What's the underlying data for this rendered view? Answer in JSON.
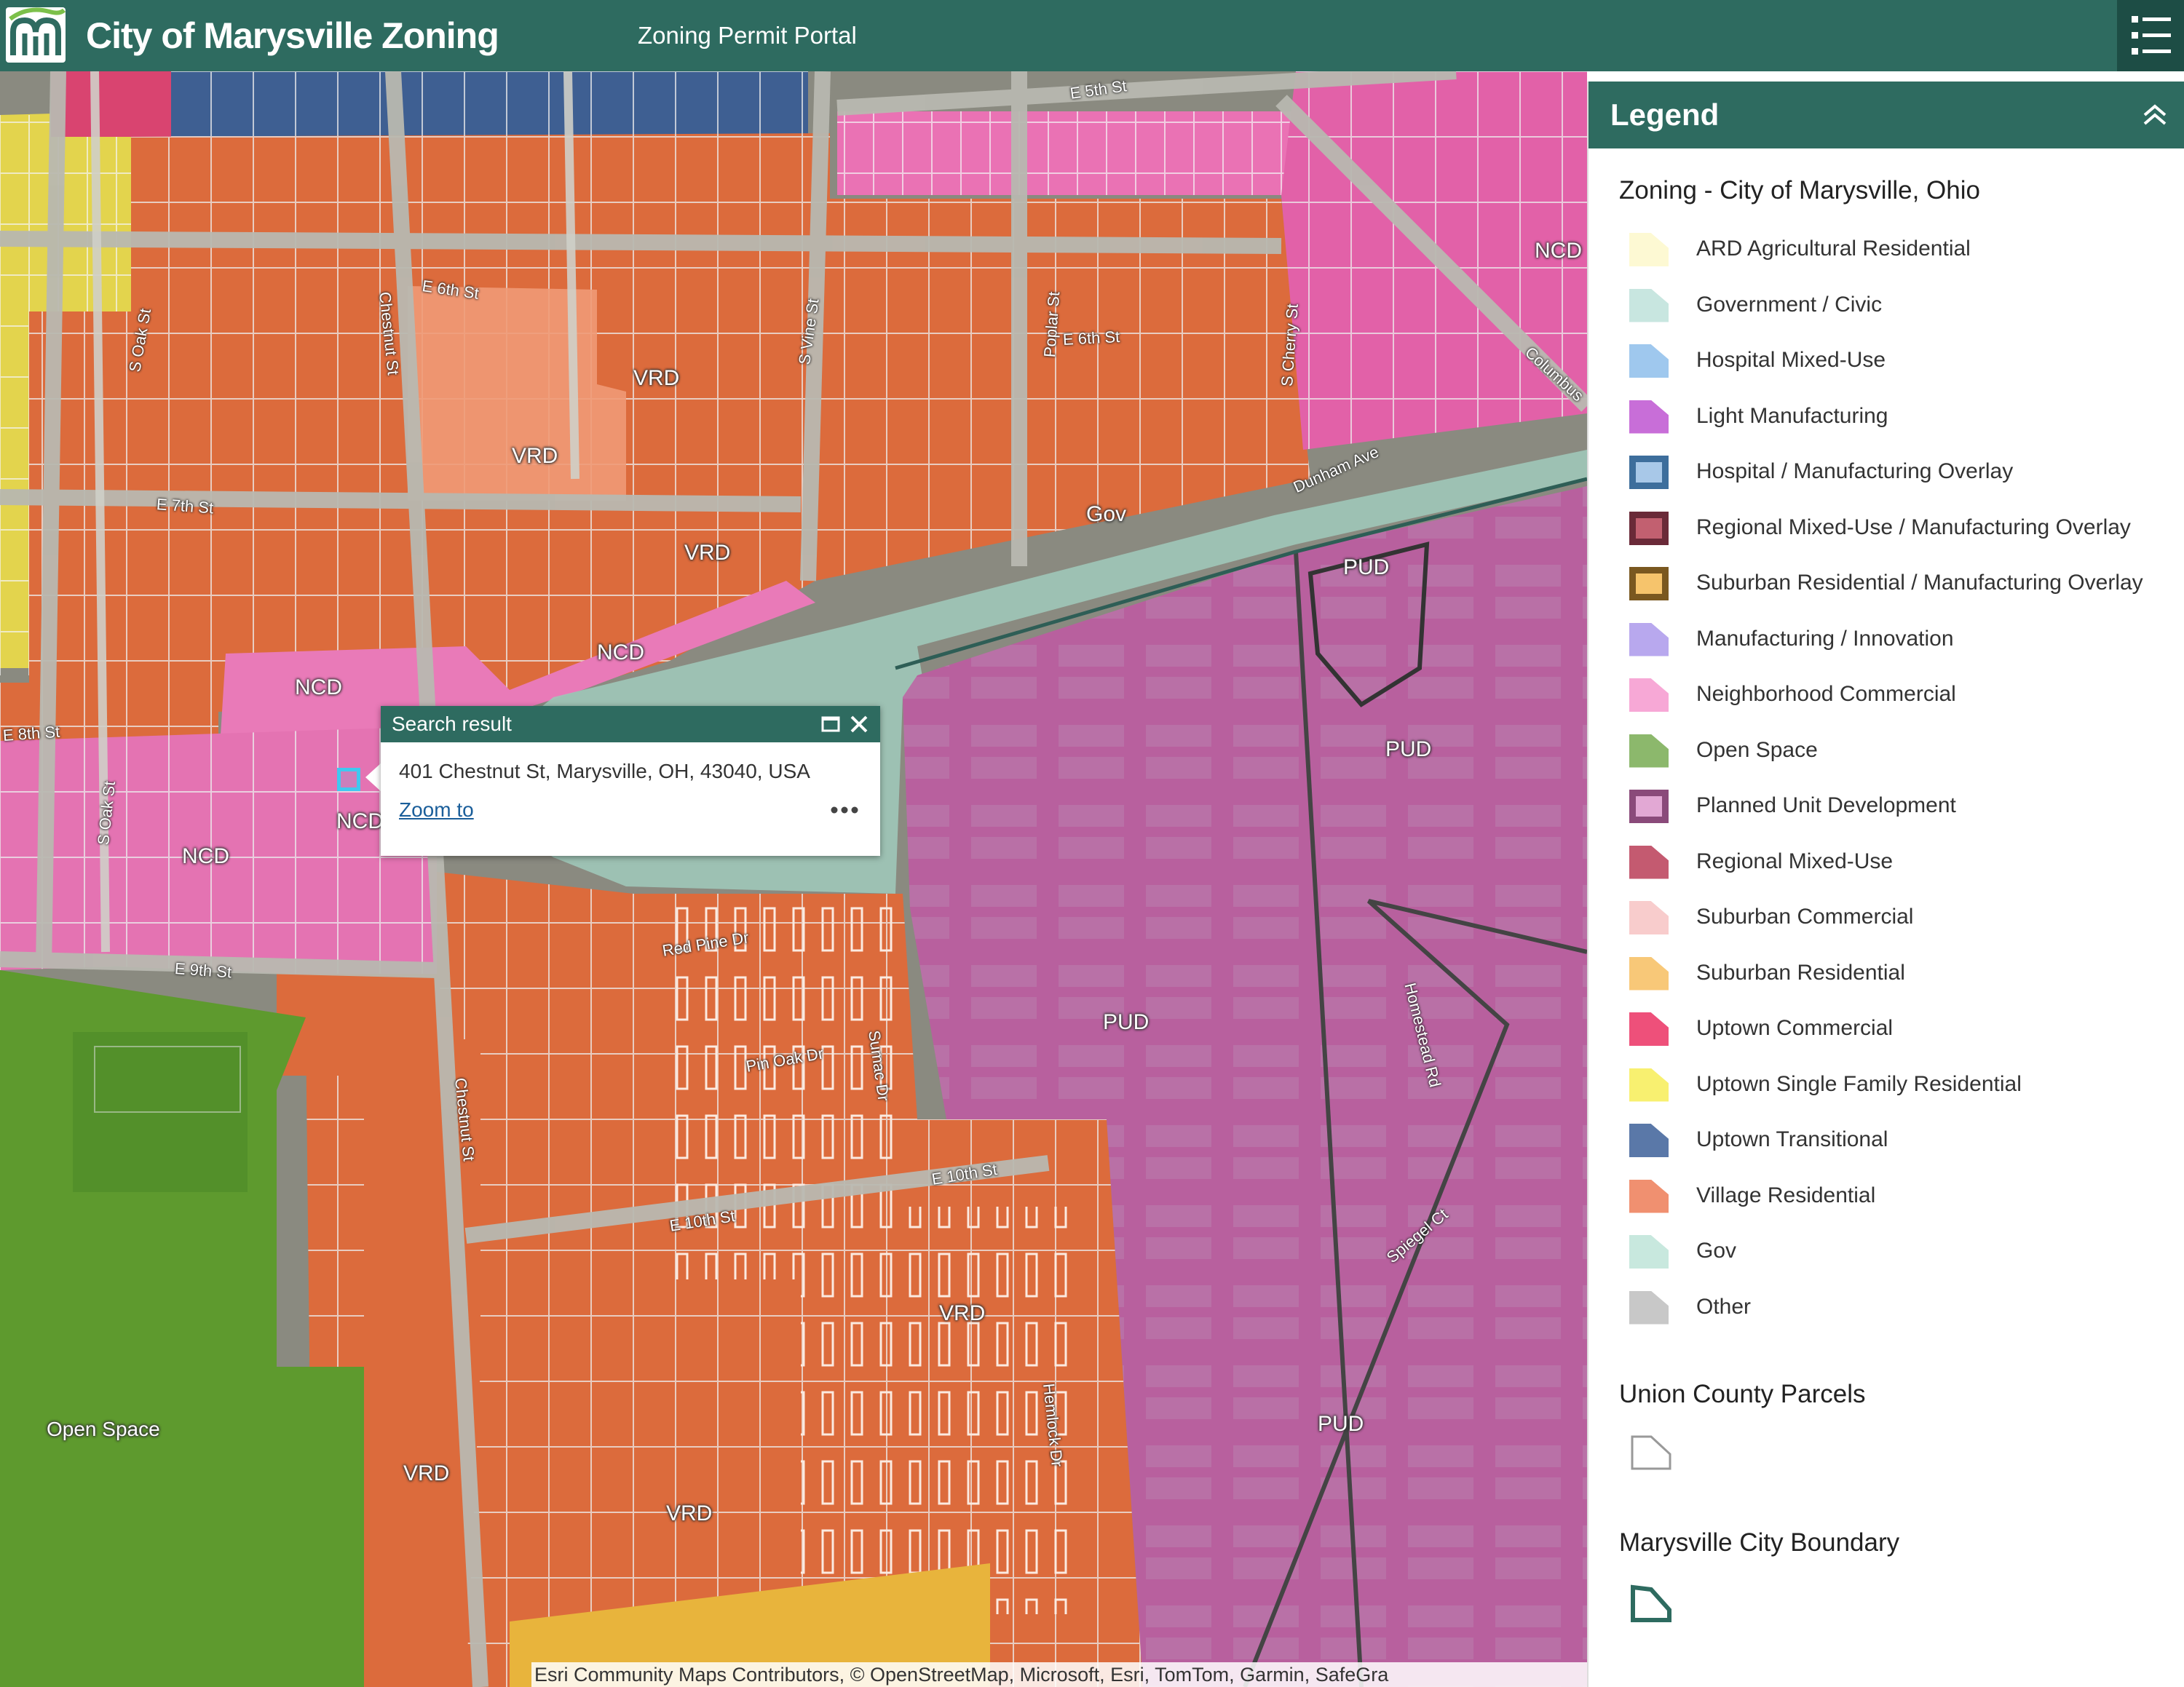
{
  "header": {
    "title": "City of Marysville Zoning",
    "subtitle": "Zoning Permit Portal",
    "brand_color": "#2e6b60"
  },
  "map": {
    "zone_labels": [
      "VRD",
      "VRD",
      "VRD",
      "NCD",
      "NCD",
      "NCD",
      "NCD",
      "NCD",
      "Gov",
      "PUD",
      "PUD",
      "PUD",
      "PUD",
      "VRD",
      "VRD",
      "VRD",
      "Open Space"
    ],
    "street_labels": [
      "E 5th St",
      "E 6th St",
      "E 6th St",
      "E 7th St",
      "E 8th St",
      "E 9th St",
      "E 10th St",
      "E 10th St",
      "Chestnut St",
      "Chestnut St",
      "S Oak St",
      "S Vine St",
      "Poplar St",
      "S Cherry St",
      "Dunham Ave",
      "Columbus",
      "Red Pine Dr",
      "Pin Oak Dr",
      "Sumac Dr",
      "Homestead Rd",
      "Hemlock Dr",
      "Spiegel Ct",
      "S Oak St"
    ],
    "attribution": "Esri Community Maps Contributors, © OpenStreetMap, Microsoft, Esri, TomTom, Garmin, SafeGra"
  },
  "popup": {
    "title": "Search result",
    "address": "401 Chestnut St, Marysville, OH, 43040, USA",
    "zoom_label": "Zoom to",
    "more_label": "•••"
  },
  "legend": {
    "title": "Legend",
    "zoning_title": "Zoning - City of Marysville, Ohio",
    "items": [
      {
        "label": "ARD Agricultural Residential",
        "color": "#fdf9d3"
      },
      {
        "label": "Government / Civic",
        "color": "#c8e6e0"
      },
      {
        "label": "Hospital Mixed-Use",
        "color": "#9fc8ee"
      },
      {
        "label": "Light Manufacturing",
        "color": "#c86ed8"
      },
      {
        "label": "Hospital / Manufacturing Overlay",
        "color": "#a8c8e8"
      },
      {
        "label": "Regional Mixed-Use / Manufacturing Overlay",
        "color": "#c26070"
      },
      {
        "label": "Suburban Residential / Manufacturing Overlay",
        "color": "#f6c46c"
      },
      {
        "label": "Manufacturing / Innovation",
        "color": "#b8a8ee"
      },
      {
        "label": "Neighborhood Commercial",
        "color": "#f7a8d6"
      },
      {
        "label": "Open Space",
        "color": "#8cb86c"
      },
      {
        "label": "Planned Unit Development",
        "color": "#e2a8d4"
      },
      {
        "label": "Regional Mixed-Use",
        "color": "#c45a70"
      },
      {
        "label": "Suburban Commercial",
        "color": "#f8cccc"
      },
      {
        "label": "Suburban Residential",
        "color": "#f8c878"
      },
      {
        "label": "Uptown Commercial",
        "color": "#ee507a"
      },
      {
        "label": "Uptown Single Family Residential",
        "color": "#f8f070"
      },
      {
        "label": "Uptown Transitional",
        "color": "#5a78a8"
      },
      {
        "label": "Village Residential",
        "color": "#f09070"
      },
      {
        "label": "Gov",
        "color": "#c8e8de"
      },
      {
        "label": "Other",
        "color": "#c8c8c8"
      }
    ],
    "parcels_title": "Union County Parcels",
    "boundary_title": "Marysville City Boundary"
  }
}
